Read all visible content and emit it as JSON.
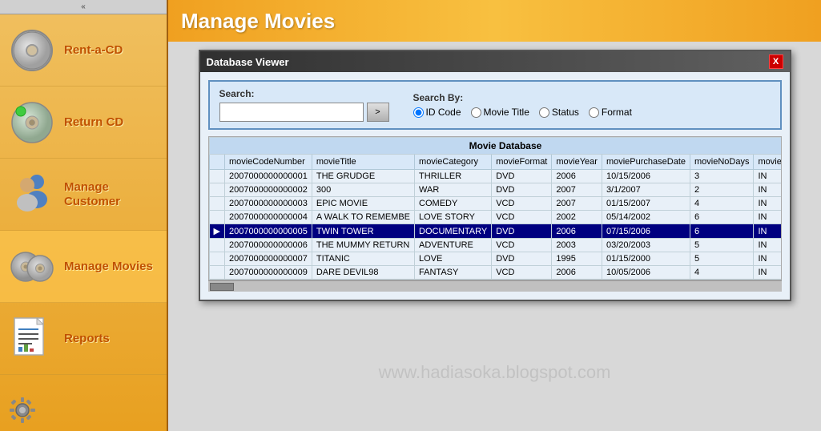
{
  "sidebar": {
    "collapse_icon": "«",
    "items": [
      {
        "id": "rent-cd",
        "label": "Rent-a-CD",
        "icon": "cd"
      },
      {
        "id": "return-cd",
        "label": "Return CD",
        "icon": "cd-green"
      },
      {
        "id": "manage-customer",
        "label": "Manage Customer",
        "icon": "people"
      },
      {
        "id": "manage-movies",
        "label": "Manage Movies",
        "icon": "movies"
      },
      {
        "id": "reports",
        "label": "Reports",
        "icon": "reports"
      }
    ]
  },
  "header": {
    "title": "Manage Movies"
  },
  "db_window": {
    "title": "Database Viewer",
    "close_btn": "X",
    "search": {
      "label": "Search:",
      "value": "",
      "placeholder": "",
      "go_btn": ">",
      "search_by_label": "Search By:",
      "options": [
        {
          "id": "id-code",
          "label": "ID Code",
          "checked": true
        },
        {
          "id": "movie-title",
          "label": "Movie Title",
          "checked": false
        },
        {
          "id": "status",
          "label": "Status",
          "checked": false
        },
        {
          "id": "format",
          "label": "Format",
          "checked": false
        }
      ]
    },
    "table": {
      "title": "Movie Database",
      "columns": [
        "movieCodeNumber",
        "movieTitle",
        "movieCategory",
        "movieFormat",
        "movieYear",
        "moviePurchaseDate",
        "movieNoDays",
        "movieStat"
      ],
      "rows": [
        {
          "selected": false,
          "arrow": "",
          "code": "2007000000000001",
          "title": "THE GRUDGE",
          "category": "THRILLER",
          "format": "DVD",
          "year": "2006",
          "purchase_date": "10/15/2006",
          "no_days": "3",
          "status": "IN"
        },
        {
          "selected": false,
          "arrow": "",
          "code": "2007000000000002",
          "title": "300",
          "category": "WAR",
          "format": "DVD",
          "year": "2007",
          "purchase_date": "3/1/2007",
          "no_days": "2",
          "status": "IN"
        },
        {
          "selected": false,
          "arrow": "",
          "code": "2007000000000003",
          "title": "EPIC MOVIE",
          "category": "COMEDY",
          "format": "VCD",
          "year": "2007",
          "purchase_date": "01/15/2007",
          "no_days": "4",
          "status": "IN"
        },
        {
          "selected": false,
          "arrow": "",
          "code": "2007000000000004",
          "title": "A WALK TO REMEMBE",
          "category": "LOVE STORY",
          "format": "VCD",
          "year": "2002",
          "purchase_date": "05/14/2002",
          "no_days": "6",
          "status": "IN"
        },
        {
          "selected": true,
          "arrow": "▶",
          "code": "2007000000000005",
          "title": "TWIN TOWER",
          "category": "DOCUMENTARY",
          "format": "DVD",
          "year": "2006",
          "purchase_date": "07/15/2006",
          "no_days": "6",
          "status": "IN"
        },
        {
          "selected": false,
          "arrow": "",
          "code": "2007000000000006",
          "title": "THE MUMMY RETURN",
          "category": "ADVENTURE",
          "format": "VCD",
          "year": "2003",
          "purchase_date": "03/20/2003",
          "no_days": "5",
          "status": "IN"
        },
        {
          "selected": false,
          "arrow": "",
          "code": "2007000000000007",
          "title": "TITANIC",
          "category": "LOVE",
          "format": "DVD",
          "year": "1995",
          "purchase_date": "01/15/2000",
          "no_days": "5",
          "status": "IN"
        },
        {
          "selected": false,
          "arrow": "",
          "code": "2007000000000009",
          "title": "DARE DEVIL98",
          "category": "FANTASY",
          "format": "VCD",
          "year": "2006",
          "purchase_date": "10/05/2006",
          "no_days": "4",
          "status": "IN"
        }
      ]
    }
  },
  "watermark": "www.hadiasoka.blogspot.com"
}
